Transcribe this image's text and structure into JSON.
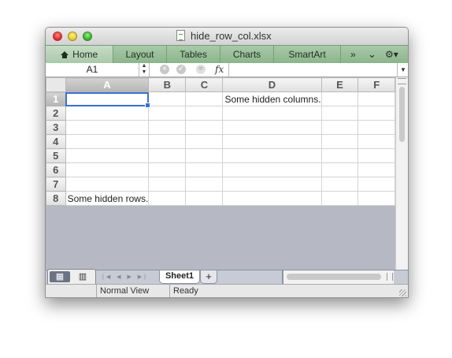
{
  "window": {
    "title": "hide_row_col.xlsx"
  },
  "ribbon": {
    "tabs": [
      "Home",
      "Layout",
      "Tables",
      "Charts",
      "SmartArt"
    ],
    "overflow_icon": "»",
    "collapse_icon": "⌄",
    "settings_icon": "⚙▾"
  },
  "formula_bar": {
    "name_box": "A1",
    "fx_label": "fx",
    "cancel_icon": "×",
    "enter_icon": "✓",
    "equals_icon": "=",
    "value": ""
  },
  "grid": {
    "columns": [
      "A",
      "B",
      "C",
      "D",
      "E",
      "F"
    ],
    "rows": [
      "1",
      "2",
      "3",
      "4",
      "5",
      "6",
      "7",
      "8"
    ],
    "selected_cell": "A1",
    "cells": {
      "D1": "Some hidden columns.",
      "A8": "Some hidden rows."
    }
  },
  "sheet_tabs": {
    "tabs": [
      "Sheet1"
    ],
    "add_label": "+",
    "nav_arrows": "|◀ ◀ ▶ ▶|"
  },
  "status_bar": {
    "view": "Normal View",
    "state": "Ready"
  }
}
